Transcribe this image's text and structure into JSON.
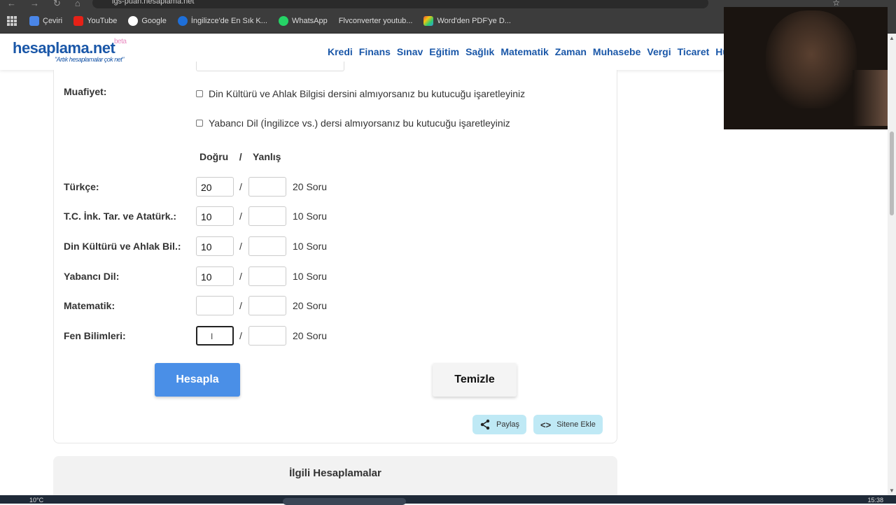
{
  "browser": {
    "url": "lgs-puan.hesaplama.net",
    "bookmarks": [
      {
        "label": "Çeviri",
        "color": "#4a86e8"
      },
      {
        "label": "YouTube",
        "color": "#e62117"
      },
      {
        "label": "Google",
        "color": "#ffffff"
      },
      {
        "label": "İngilizce'de En Sık K...",
        "color": "#1e6fd9"
      },
      {
        "label": "WhatsApp",
        "color": "#25d366"
      },
      {
        "label": "Flvconverter youtub...",
        "color": "#3c3c3c"
      },
      {
        "label": "Word'den PDF'ye D...",
        "color": "#e07b39"
      }
    ]
  },
  "site": {
    "logo": "hesaplama.net",
    "beta": "beta",
    "tagline": "\"Artık hesaplamalar çok net\"",
    "nav": [
      "Kredi",
      "Finans",
      "Sınav",
      "Eğitim",
      "Sağlık",
      "Matematik",
      "Zaman",
      "Muhasebe",
      "Vergi",
      "Ticaret",
      "Hukuk"
    ]
  },
  "form": {
    "exemption_label": "Muafiyet:",
    "exemption_options": [
      "Din Kültürü ve Ahlak Bilgisi dersini almıyorsanız bu kutucuğu işaretleyiniz",
      "Yabancı Dil (İngilizce vs.) dersi almıyorsanız bu kutucuğu işaretleyiniz"
    ],
    "col_correct": "Doğru",
    "col_sep": "/",
    "col_wrong": "Yanlış",
    "rows": [
      {
        "label": "Türkçe:",
        "correct": "20",
        "wrong": "",
        "total": "20 Soru"
      },
      {
        "label": "T.C. İnk. Tar. ve Atatürk.:",
        "correct": "10",
        "wrong": "",
        "total": "10 Soru"
      },
      {
        "label": "Din Kültürü ve Ahlak Bil.:",
        "correct": "10",
        "wrong": "",
        "total": "10 Soru"
      },
      {
        "label": "Yabancı Dil:",
        "correct": "10",
        "wrong": "",
        "total": "10 Soru"
      },
      {
        "label": "Matematik:",
        "correct": "",
        "wrong": "",
        "total": "20 Soru"
      },
      {
        "label": "Fen Bilimleri:",
        "correct": "",
        "wrong": "",
        "total": "20 Soru"
      }
    ],
    "calculate_label": "Hesapla",
    "clear_label": "Temizle",
    "share_label": "Paylaş",
    "embed_label": "Sitene Ekle"
  },
  "related": {
    "title": "İlgili Hesaplamalar"
  },
  "taskbar": {
    "temp": "10°C",
    "time": "15:38"
  }
}
